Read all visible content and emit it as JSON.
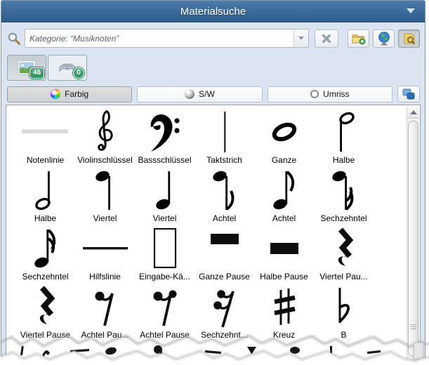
{
  "titlebar": {
    "title": "Materialsuche"
  },
  "toolbar": {
    "search_value": "Kategorie: “Musiknoten”"
  },
  "tabs": {
    "images_count": "46",
    "materials_count": "0"
  },
  "filters": {
    "farbig": "Farbig",
    "sw": "S/W",
    "umriss": "Umriss"
  },
  "grid": {
    "items": [
      {
        "label": "Notenlinie",
        "sym": "staff-line"
      },
      {
        "label": "Violinschlüssel",
        "sym": "treble-clef"
      },
      {
        "label": "Bassschlüssel",
        "sym": "bass-clef"
      },
      {
        "label": "Taktstrich",
        "sym": "bar-line"
      },
      {
        "label": "Ganze",
        "sym": "whole-note"
      },
      {
        "label": "Halbe",
        "sym": "half-note-down"
      },
      {
        "label": "Halbe",
        "sym": "half-note-up"
      },
      {
        "label": "Viertel",
        "sym": "quarter-note-down"
      },
      {
        "label": "Viertel",
        "sym": "quarter-note-up"
      },
      {
        "label": "Achtel",
        "sym": "eighth-note-down"
      },
      {
        "label": "Achtel",
        "sym": "eighth-note-up"
      },
      {
        "label": "Sechzehntel",
        "sym": "sixteenth-note-down"
      },
      {
        "label": "Sechzehntel",
        "sym": "sixteenth-note-up"
      },
      {
        "label": "Hilfslinie",
        "sym": "ledger-line"
      },
      {
        "label": "Eingabe-Kä...",
        "sym": "input-box"
      },
      {
        "label": "Ganze Pause",
        "sym": "whole-rest"
      },
      {
        "label": "Halbe Pause",
        "sym": "half-rest"
      },
      {
        "label": "Viertel Pau...",
        "sym": "quarter-rest"
      },
      {
        "label": "Viertel Pause",
        "sym": "quarter-rest"
      },
      {
        "label": "Achtel Pau...",
        "sym": "eighth-rest"
      },
      {
        "label": "Achtel Pause",
        "sym": "eighth-rest-alt"
      },
      {
        "label": "Sechzehnt...",
        "sym": "sixteenth-rest"
      },
      {
        "label": "Kreuz",
        "sym": "sharp"
      },
      {
        "label": "B",
        "sym": "flat"
      }
    ]
  },
  "colors": {
    "titlebar_top": "#4d7aa6",
    "titlebar_bottom": "#2e5d8d",
    "panel_bg": "#dbe5f1",
    "badge_green": "#3aa06a",
    "list_border": "#96a4b6"
  }
}
